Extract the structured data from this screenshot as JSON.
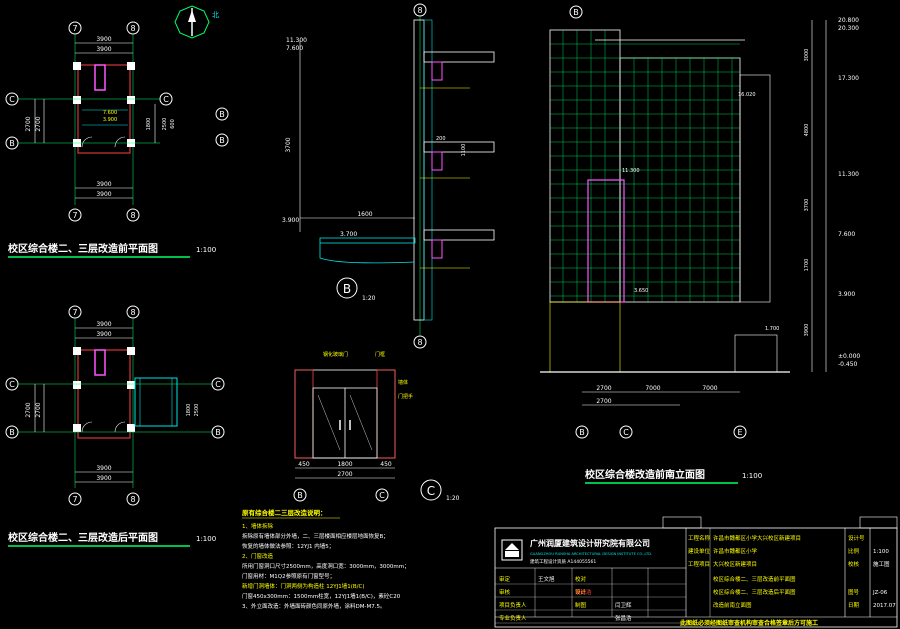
{
  "drawings": {
    "plan_before": {
      "title": "校区综合楼二、三层改造前平面图",
      "scale": "1:100"
    },
    "plan_after": {
      "title": "校区综合楼二、三层改造后平面图",
      "scale": "1:100"
    },
    "section_b": {
      "mark": "B",
      "scale": "1:20"
    },
    "door_detail": {
      "mark": "C",
      "scale": "1:20"
    },
    "elevation": {
      "title": "校区综合楼改造前南立面图",
      "scale": "1:100"
    },
    "north_label": "北"
  },
  "axes": {
    "plan": [
      "7",
      "8",
      "B",
      "C"
    ],
    "section": "8",
    "elevation": [
      "B",
      "C",
      "E"
    ]
  },
  "dims": {
    "plan_top": [
      "3900",
      "3900"
    ],
    "plan_side": [
      "2700",
      "2700"
    ],
    "plan_inner": [
      "1800",
      "2500",
      "600"
    ],
    "plan_level": "7.600",
    "plan_level2": "3.900",
    "section_levels": [
      "11.300",
      "7.600",
      "3.900",
      "3.700"
    ],
    "section_h": [
      "3700",
      "1600",
      "200",
      "1100"
    ],
    "door_w": [
      "450",
      "1800",
      "450"
    ],
    "door_total": "2700",
    "elev_right": [
      "20.800",
      "20.300",
      "17.300",
      "11.300",
      "7.600",
      "3.900",
      "±0.000",
      "-0.450"
    ],
    "elev_right_h": [
      "3000",
      "4800",
      "3700",
      "1700",
      "3900"
    ],
    "elev_inner": [
      "16.020",
      "11.300",
      "3.650",
      "1.700"
    ],
    "elev_bottom": [
      "2700",
      "7000",
      "7000"
    ],
    "elev_total": "2700"
  },
  "notes": {
    "heading": "原有综合楼二三层改造说明：",
    "lines": [
      "1、墙体拆除",
      "   拆除原有墙体部分外墙，二、三层楼面相应楼层地面恢复B；",
      "   恢复的墙体做法参照：12YJ1 内墙5；",
      "2、门窗改造",
      "   所用门窗洞口尺寸2500mm，高度洞口宽：3000mm，3000mm；",
      "   门窗用材：M1Q2参照原有门窗型号；",
      "   新增门洞墙体：门洞两侧为构造柱 12YJ1墙1(B/C)",
      "   门窗450x300mm：1500mm柱宽，12YJ1墙1(B/C)，素砼C20",
      "3、外立面改造：外墙面砖颜色同原外墙，涂料DM-M7.5。"
    ]
  },
  "door_labels": [
    "钢化玻璃门",
    "门框",
    "墙体",
    "门把手"
  ],
  "title_block": {
    "company": "广州润厦建筑设计研究院有限公司",
    "company_en": "GUANGZHOU RUNSHA ARCHITECTURAL DESIGN INSTITUTE CO.,LTD.",
    "qual": "建筑工程设计资质 A144055561",
    "project_label": "工程名称",
    "project": "许昌市魏都区小学大兴校区新建项目",
    "owner_label": "建设单位",
    "owner": "许昌市魏都区小学",
    "item_label": "工程项目",
    "item": "大兴校区新建项目",
    "drawing_names": [
      "校区综合楼二、三层改造前平面图",
      "校区综合楼二、三层改造后平面图",
      "改造前南立面图"
    ],
    "sign_roles": [
      "审定",
      "审核",
      "项目负责人",
      "专业负责人",
      "校对",
      "设计",
      "制图"
    ],
    "signers": [
      "王文旭",
      "蔡成浩",
      "闫卫辉",
      "张昌浩"
    ],
    "design_stage_label": "设计号",
    "scale_label": "比例",
    "scale": "1:100",
    "sheet_label": "图号",
    "sheet": "JZ-06",
    "date_label": "日期",
    "date": "2017.07",
    "stage": "施工图",
    "check_label": "校核",
    "stamp_note": "此图纸必须经图纸审查机构审查合格签章后方可施工"
  }
}
